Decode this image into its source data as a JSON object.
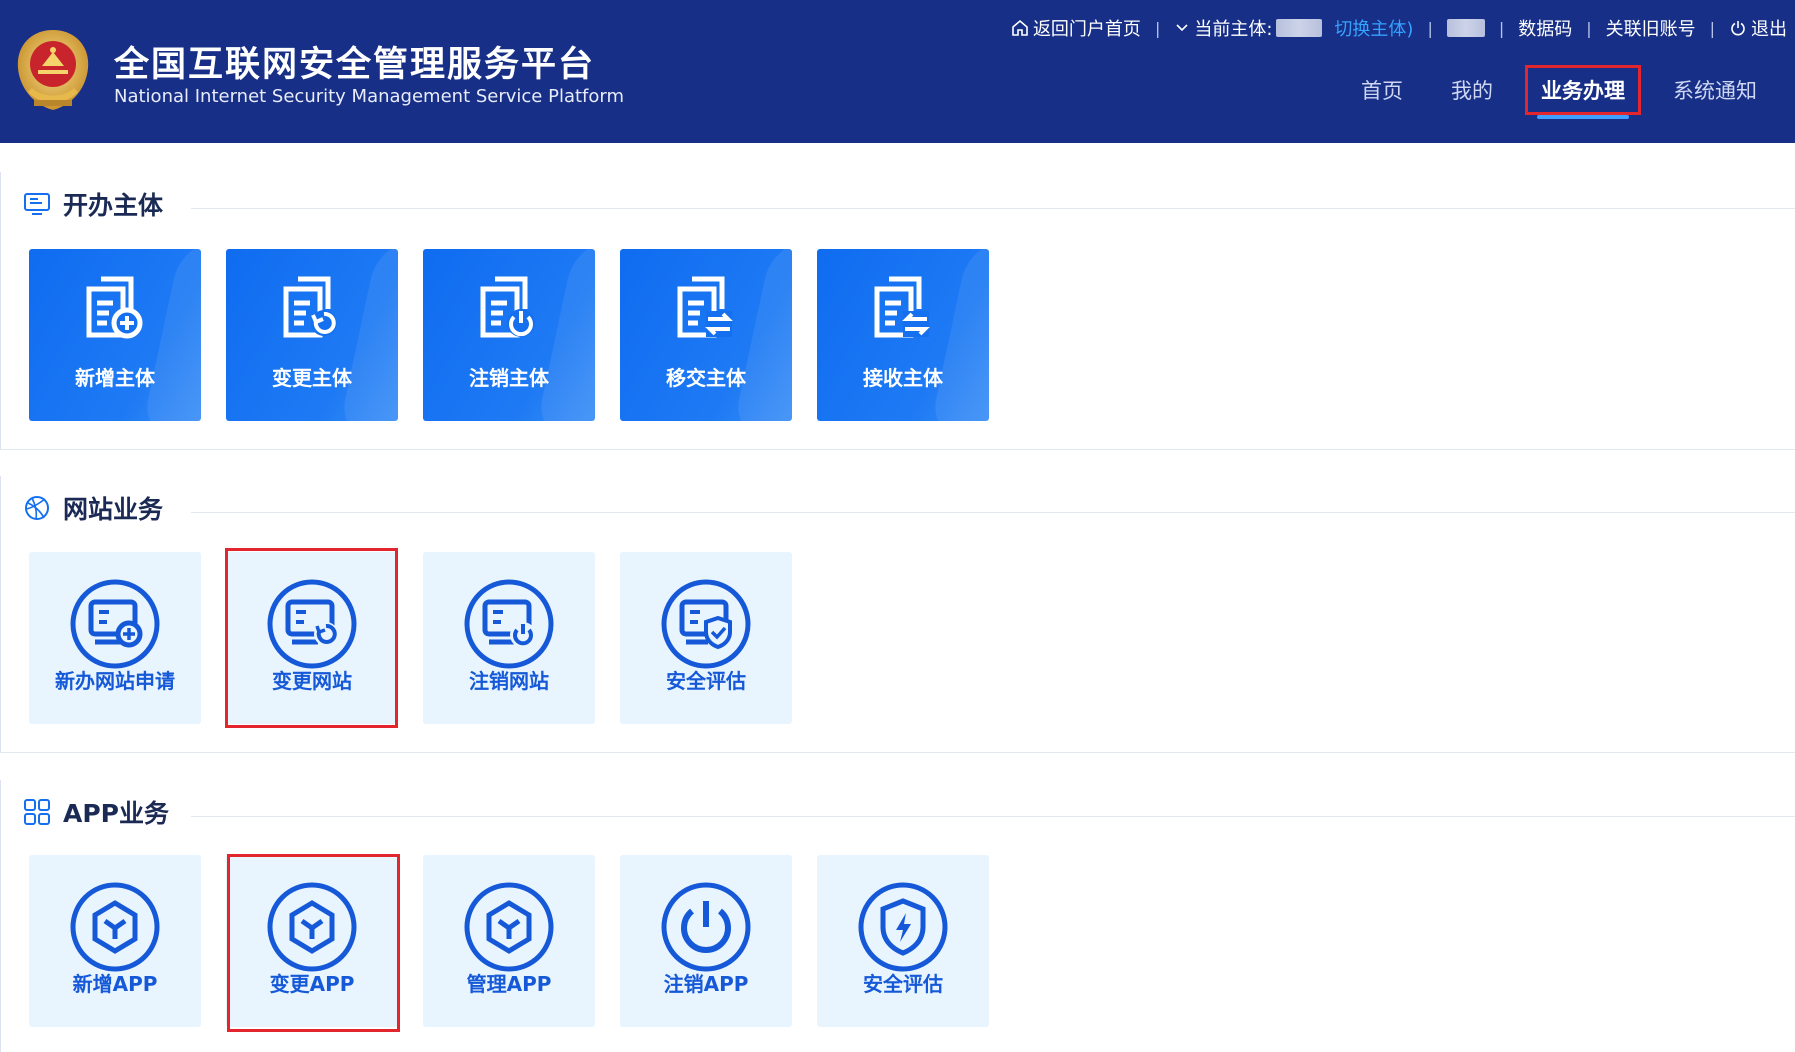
{
  "header": {
    "title_cn": "全国互联网安全管理服务平台",
    "title_en": "National Internet Security Management Service Platform",
    "topbar": {
      "home_link": "返回门户首页",
      "current_entity_label": "当前主体:",
      "switch_entity": "切换主体)",
      "data_code": "数据码",
      "link_old_account": "关联旧账号",
      "logout": "退出"
    },
    "nav": [
      {
        "label": "首页",
        "active": false
      },
      {
        "label": "我的",
        "active": false
      },
      {
        "label": "业务办理",
        "active": true
      },
      {
        "label": "系统通知",
        "active": false
      }
    ]
  },
  "sections": [
    {
      "title": "开办主体",
      "icon": "monitor-icon",
      "items": [
        "新增主体",
        "变更主体",
        "注销主体",
        "移交主体",
        "接收主体"
      ]
    },
    {
      "title": "网站业务",
      "icon": "globe-icon",
      "items": [
        "新办网站申请",
        "变更网站",
        "注销网站",
        "安全评估"
      ]
    },
    {
      "title": "APP业务",
      "icon": "grid-icon",
      "items": [
        "新增APP",
        "变更APP",
        "管理APP",
        "注销APP",
        "安全评估"
      ]
    }
  ],
  "colors": {
    "header_bg": "#172f87",
    "accent_blue": "#1570ef",
    "highlight_red": "#e3262d",
    "card_light": "#e8f4fe"
  }
}
